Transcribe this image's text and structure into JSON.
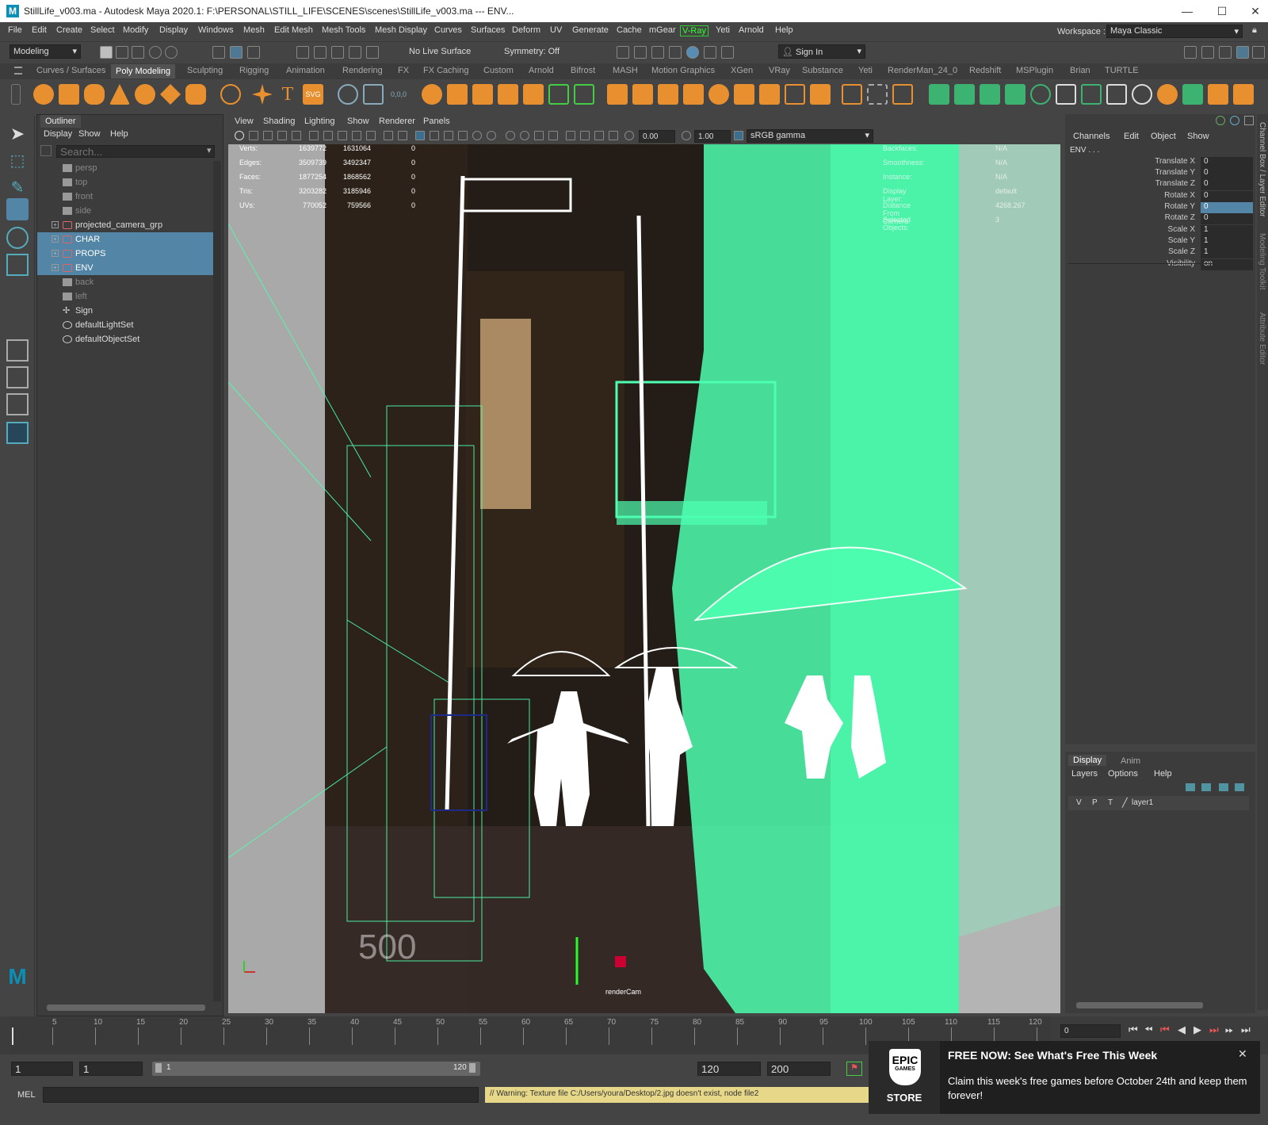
{
  "window": {
    "title": "StillLife_v003.ma - Autodesk Maya 2020.1: F:\\PERSONAL\\STILL_LIFE\\SCENES\\scenes\\StillLife_v003.ma  ---  ENV...",
    "logo": "M",
    "minimize": "—",
    "maximize": "☐",
    "close": "✕"
  },
  "menubar": {
    "items": [
      "File",
      "Edit",
      "Create",
      "Select",
      "Modify",
      "Display",
      "Windows",
      "Mesh",
      "Edit Mesh",
      "Mesh Tools",
      "Mesh Display",
      "Curves",
      "Surfaces",
      "Deform",
      "UV",
      "Generate",
      "Cache",
      "mGear",
      "V-Ray",
      "Yeti",
      "Arnold",
      "Help"
    ],
    "workspace_label": "Workspace :",
    "workspace_value": "Maya Classic"
  },
  "statusline": {
    "menuset": "Modeling",
    "live_surface": "No Live Surface",
    "symmetry": "Symmetry: Off",
    "sign_in": "Sign In"
  },
  "shelf_tabs": {
    "items": [
      "Curves / Surfaces",
      "Poly Modeling",
      "Sculpting",
      "Rigging",
      "Animation",
      "Rendering",
      "FX",
      "FX Caching",
      "Custom",
      "Arnold",
      "Bifrost",
      "MASH",
      "Motion Graphics",
      "XGen",
      "VRay",
      "Substance",
      "Yeti",
      "RenderMan_24_0",
      "Redshift",
      "MSPlugin",
      "Brian",
      "TURTLE"
    ],
    "active": "Poly Modeling"
  },
  "shelf": {
    "accent_orange": "#f0a040",
    "accent_green": "#3cb371"
  },
  "outliner": {
    "tab": "Outliner",
    "menu": [
      "Display",
      "Show",
      "Help"
    ],
    "search_placeholder": "Search...",
    "items": [
      {
        "label": "persp",
        "kind": "camera",
        "dim": true
      },
      {
        "label": "top",
        "kind": "camera",
        "dim": true
      },
      {
        "label": "front",
        "kind": "camera",
        "dim": true
      },
      {
        "label": "side",
        "kind": "camera",
        "dim": true
      },
      {
        "label": "projected_camera_grp",
        "kind": "group",
        "expand": true
      },
      {
        "label": "CHAR",
        "kind": "group",
        "expand": true,
        "selected": true
      },
      {
        "label": "PROPS",
        "kind": "group",
        "expand": true,
        "selected": true
      },
      {
        "label": "ENV",
        "kind": "group",
        "expand": true,
        "selected": true
      },
      {
        "label": "back",
        "kind": "camera",
        "dim": true
      },
      {
        "label": "left",
        "kind": "camera",
        "dim": true
      },
      {
        "label": "Sign",
        "kind": "locator"
      },
      {
        "label": "defaultLightSet",
        "kind": "set"
      },
      {
        "label": "defaultObjectSet",
        "kind": "set"
      }
    ]
  },
  "viewport": {
    "menu": [
      "View",
      "Shading",
      "Lighting",
      "Show",
      "Renderer",
      "Panels"
    ],
    "exposure": "0.00",
    "gamma": "1.00",
    "colorspace": "sRGB gamma",
    "camera_label": "renderCam",
    "watermark": "500",
    "hud": {
      "labels": [
        "Verts:",
        "Edges:",
        "Faces:",
        "Tris:",
        "UVs:"
      ],
      "col1": [
        "1639772",
        "3509739",
        "1877254",
        "3203282",
        "770052"
      ],
      "col2": [
        "1631064",
        "3492347",
        "1868562",
        "3185946",
        "759566"
      ],
      "col3": [
        "0",
        "0",
        "0",
        "0",
        "0"
      ],
      "right_labels": [
        "Backfaces:",
        "Smoothness:",
        "Instance:",
        "Display Layer:",
        "Distance From Camera:",
        "Selected Objects:"
      ],
      "right_values": [
        "N/A",
        "N/A",
        "N/A",
        "default",
        "4268.267",
        "3"
      ]
    },
    "wire_color": "#4dffb0"
  },
  "channelbox": {
    "menu": [
      "Channels",
      "Edit",
      "Object",
      "Show"
    ],
    "object": "ENV . . .",
    "attrs": [
      {
        "label": "Translate X",
        "value": "0"
      },
      {
        "label": "Translate Y",
        "value": "0"
      },
      {
        "label": "Translate Z",
        "value": "0"
      },
      {
        "label": "Rotate X",
        "value": "0"
      },
      {
        "label": "Rotate Y",
        "value": "0",
        "highlight": true
      },
      {
        "label": "Rotate Z",
        "value": "0"
      },
      {
        "label": "Scale X",
        "value": "1"
      },
      {
        "label": "Scale Y",
        "value": "1"
      },
      {
        "label": "Scale Z",
        "value": "1"
      },
      {
        "label": "Visibility",
        "value": "on"
      }
    ]
  },
  "layer_editor": {
    "tabs": [
      "Display",
      "Anim"
    ],
    "menu": [
      "Layers",
      "Options",
      "Help"
    ],
    "layer": {
      "v": "V",
      "p": "P",
      "t": "T",
      "name": "layer1"
    }
  },
  "side_tabs": [
    "Channel Box / Layer Editor",
    "Modeling Toolkit",
    "Attribute Editor"
  ],
  "timeline": {
    "ticks": [
      "5",
      "10",
      "15",
      "20",
      "25",
      "30",
      "35",
      "40",
      "45",
      "50",
      "55",
      "60",
      "65",
      "70",
      "75",
      "80",
      "85",
      "90",
      "95",
      "100",
      "105",
      "110",
      "115",
      "120"
    ],
    "current_frame": "0"
  },
  "range": {
    "start": "1",
    "start2": "1",
    "slider_start": "1",
    "slider_end": "120",
    "end": "120",
    "end2": "200"
  },
  "command": {
    "label": "MEL",
    "warning": "// Warning: Texture file C:/Users/youra/Desktop/2.jpg doesn't exist, node file2"
  },
  "epic": {
    "logo_top": "EPIC",
    "logo_mid": "GAMES",
    "logo_bottom": "STORE",
    "title": "FREE NOW: See What's Free This Week",
    "body": "Claim this week's free games before October 24th and keep them forever!",
    "close": "✕"
  }
}
